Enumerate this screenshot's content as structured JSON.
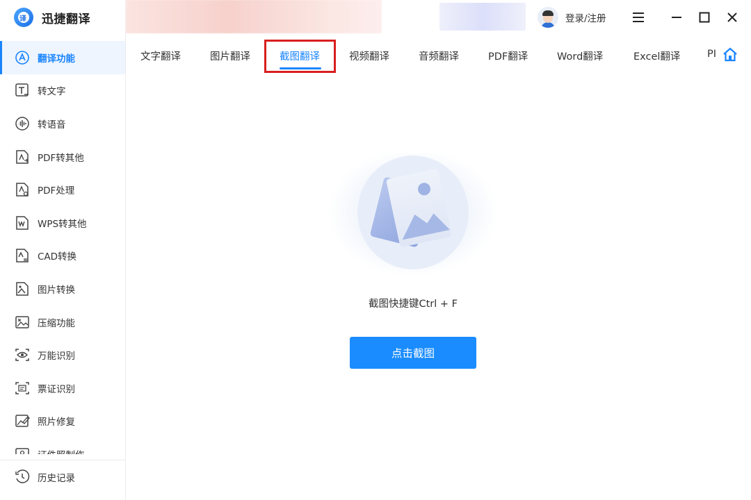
{
  "app": {
    "title": "迅捷翻译",
    "logo_glyph": "译"
  },
  "sidebar": {
    "items": [
      {
        "label": "翻译功能",
        "icon": "translate-a-icon",
        "active": true
      },
      {
        "label": "转文字",
        "icon": "text-t-icon"
      },
      {
        "label": "转语音",
        "icon": "voice-wave-icon"
      },
      {
        "label": "PDF转其他",
        "icon": "pdf-convert-icon"
      },
      {
        "label": "PDF处理",
        "icon": "pdf-process-icon"
      },
      {
        "label": "WPS转其他",
        "icon": "wps-convert-icon"
      },
      {
        "label": "CAD转换",
        "icon": "cad-convert-icon"
      },
      {
        "label": "图片转换",
        "icon": "image-convert-icon"
      },
      {
        "label": "压缩功能",
        "icon": "compress-icon"
      },
      {
        "label": "万能识别",
        "icon": "eye-scan-icon"
      },
      {
        "label": "票证识别",
        "icon": "ticket-scan-icon"
      },
      {
        "label": "照片修复",
        "icon": "photo-repair-icon"
      },
      {
        "label": "证件照制作",
        "icon": "id-photo-icon"
      }
    ],
    "history_label": "历史记录"
  },
  "header": {
    "login_label": "登录/注册"
  },
  "tabs": [
    {
      "label": "文字翻译"
    },
    {
      "label": "图片翻译"
    },
    {
      "label": "截图翻译",
      "active": true
    },
    {
      "label": "视频翻译"
    },
    {
      "label": "音频翻译"
    },
    {
      "label": "PDF翻译"
    },
    {
      "label": "Word翻译"
    },
    {
      "label": "Excel翻译"
    },
    {
      "label": "PI"
    }
  ],
  "main": {
    "hint": "截图快捷键Ctrl + F",
    "button_label": "点击截图"
  },
  "colors": {
    "accent": "#1a84ff",
    "button": "#1a8cff",
    "highlight": "#d81e1e",
    "active_bg": "#eef5ff"
  }
}
